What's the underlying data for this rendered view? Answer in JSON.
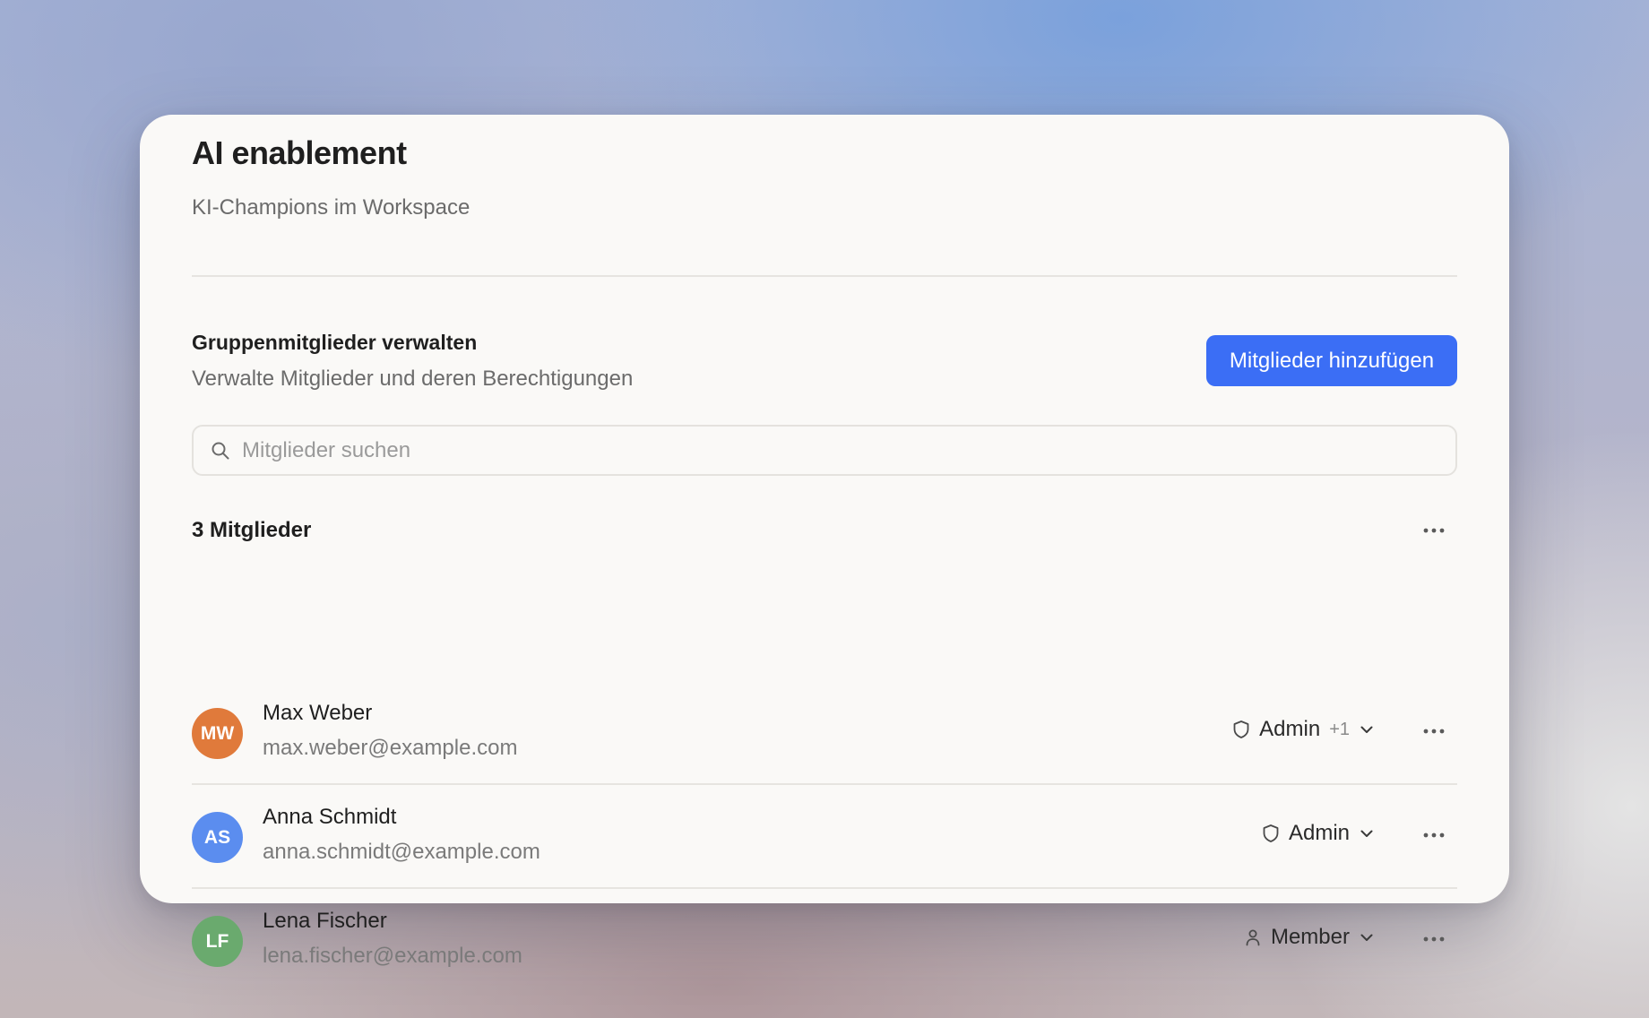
{
  "header": {
    "title": "AI enablement",
    "subtitle": "KI-Champions im Workspace"
  },
  "section": {
    "title": "Gruppenmitglieder verwalten",
    "description": "Verwalte Mitglieder und deren Berechtigungen",
    "add_button_label": "Mitglieder hinzufügen"
  },
  "search": {
    "placeholder": "Mitglieder suchen",
    "value": ""
  },
  "members": {
    "count_label": "3 Mitglieder",
    "items": [
      {
        "initials": "MW",
        "name": "Max Weber",
        "email": "max.weber@example.com",
        "role": "Admin",
        "role_icon": "shield-icon",
        "role_extra": "+1",
        "avatar_color": "#e07a3b"
      },
      {
        "initials": "AS",
        "name": "Anna Schmidt",
        "email": "anna.schmidt@example.com",
        "role": "Admin",
        "role_icon": "shield-icon",
        "role_extra": "",
        "avatar_color": "#5b8def"
      },
      {
        "initials": "LF",
        "name": "Lena Fischer",
        "email": "lena.fischer@example.com",
        "role": "Member",
        "role_icon": "user-icon",
        "role_extra": "",
        "avatar_color": "#6aaa6e"
      }
    ]
  },
  "colors": {
    "accent": "#3b6ef5",
    "card_background": "#faf9f7",
    "divider": "#e6e4e0"
  }
}
